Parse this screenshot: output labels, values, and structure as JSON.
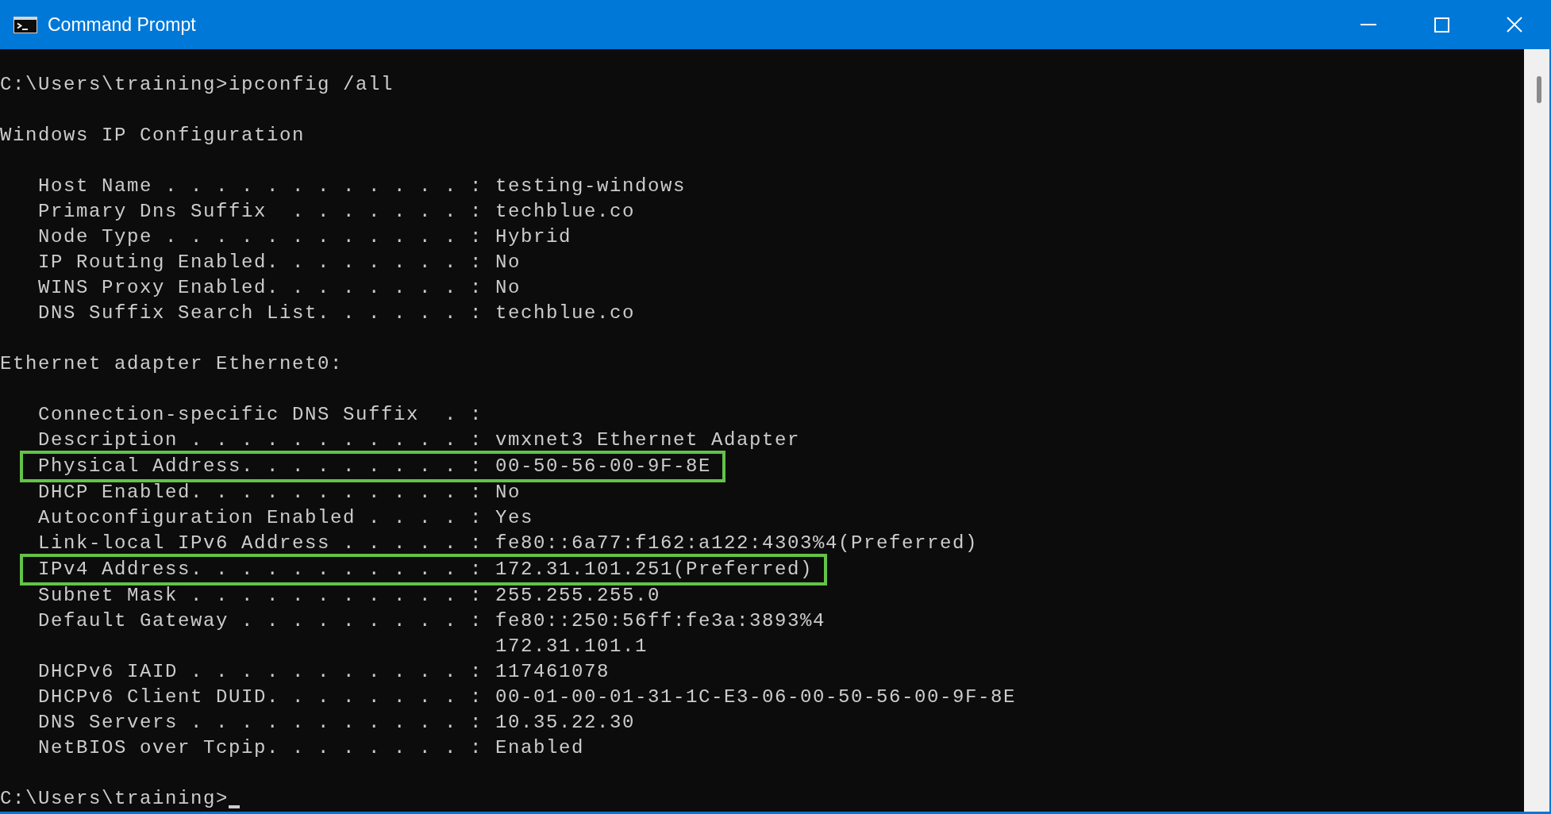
{
  "window": {
    "title": "Command Prompt"
  },
  "console": {
    "lines": [
      {
        "kind": "prompt",
        "text": "C:\\Users\\training>ipconfig /all",
        "cursor": false
      },
      {
        "kind": "blank"
      },
      {
        "kind": "text",
        "text": "Windows IP Configuration"
      },
      {
        "kind": "blank"
      },
      {
        "kind": "field",
        "label": "Host Name . . . . . . . . . . . . :",
        "value": "testing-windows",
        "highlighted": false
      },
      {
        "kind": "field",
        "label": "Primary Dns Suffix  . . . . . . . :",
        "value": "techblue.co",
        "highlighted": false
      },
      {
        "kind": "field",
        "label": "Node Type . . . . . . . . . . . . :",
        "value": "Hybrid",
        "highlighted": false
      },
      {
        "kind": "field",
        "label": "IP Routing Enabled. . . . . . . . :",
        "value": "No",
        "highlighted": false
      },
      {
        "kind": "field",
        "label": "WINS Proxy Enabled. . . . . . . . :",
        "value": "No",
        "highlighted": false
      },
      {
        "kind": "field",
        "label": "DNS Suffix Search List. . . . . . :",
        "value": "techblue.co",
        "highlighted": false
      },
      {
        "kind": "blank"
      },
      {
        "kind": "text",
        "text": "Ethernet adapter Ethernet0:"
      },
      {
        "kind": "blank"
      },
      {
        "kind": "field",
        "label": "Connection-specific DNS Suffix  . :",
        "highlighted": false
      },
      {
        "kind": "field",
        "label": "Description . . . . . . . . . . . :",
        "value": "vmxnet3 Ethernet Adapter",
        "highlighted": false
      },
      {
        "kind": "field",
        "label": "Physical Address. . . . . . . . . :",
        "value": "00-50-56-00-9F-8E",
        "highlighted": true
      },
      {
        "kind": "field",
        "label": "DHCP Enabled. . . . . . . . . . . :",
        "value": "No",
        "highlighted": false
      },
      {
        "kind": "field",
        "label": "Autoconfiguration Enabled . . . . :",
        "value": "Yes",
        "highlighted": false
      },
      {
        "kind": "field",
        "label": "Link-local IPv6 Address . . . . . :",
        "value": "fe80::6a77:f162:a122:4303%4(Preferred)",
        "highlighted": false
      },
      {
        "kind": "field",
        "label": "IPv4 Address. . . . . . . . . . . :",
        "value": "172.31.101.251(Preferred)",
        "highlighted": true
      },
      {
        "kind": "field",
        "label": "Subnet Mask . . . . . . . . . . . :",
        "value": "255.255.255.0",
        "highlighted": false
      },
      {
        "kind": "field",
        "label": "Default Gateway . . . . . . . . . :",
        "value": "fe80::250:56ff:fe3a:3893%4",
        "highlighted": false
      },
      {
        "kind": "continuation",
        "value": "172.31.101.1"
      },
      {
        "kind": "field",
        "label": "DHCPv6 IAID . . . . . . . . . . . :",
        "value": "117461078",
        "highlighted": false
      },
      {
        "kind": "field",
        "label": "DHCPv6 Client DUID. . . . . . . . :",
        "value": "00-01-00-01-31-1C-E3-06-00-50-56-00-9F-8E",
        "highlighted": false
      },
      {
        "kind": "field",
        "label": "DNS Servers . . . . . . . . . . . :",
        "value": "10.35.22.30",
        "highlighted": false
      },
      {
        "kind": "field",
        "label": "NetBIOS over Tcpip. . . . . . . . :",
        "value": "Enabled",
        "highlighted": false
      },
      {
        "kind": "blank"
      },
      {
        "kind": "prompt",
        "text": "C:\\Users\\training>",
        "cursor": true
      }
    ]
  }
}
